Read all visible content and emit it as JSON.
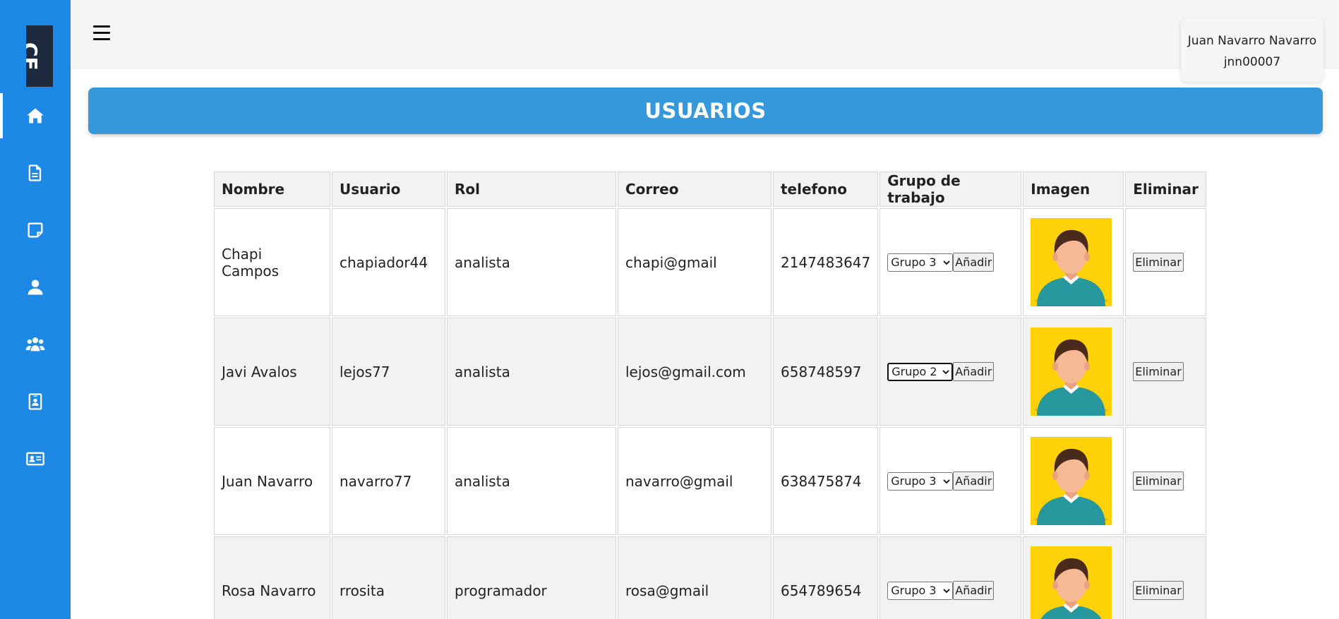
{
  "sidebar": {
    "logo_text": "CE",
    "items": [
      {
        "icon": "home-icon",
        "active": true
      },
      {
        "icon": "file-icon"
      },
      {
        "icon": "note-icon"
      },
      {
        "icon": "user-icon"
      },
      {
        "icon": "users-icon"
      },
      {
        "icon": "id-badge-icon"
      },
      {
        "icon": "id-card-icon"
      }
    ],
    "colors": {
      "background": "#1e88e5",
      "logo_bg": "#1e2a3d"
    }
  },
  "header": {
    "user": {
      "name": "Juan Navarro Navarro",
      "username": "jnn00007"
    }
  },
  "page": {
    "title": "USUARIOS",
    "title_color": "#3498db"
  },
  "table": {
    "headers": [
      "Nombre",
      "Usuario",
      "Rol",
      "Correo",
      "telefono",
      "Grupo de trabajo",
      "Imagen",
      "Eliminar"
    ],
    "rows": [
      {
        "nombre": "Chapi Campos",
        "usuario": "chapiador44",
        "rol": "analista",
        "correo": "chapi@gmail",
        "telefono": "2147483647",
        "grupo": "Grupo 3",
        "add_label": "Añadir",
        "delete_label": "Eliminar",
        "avatar": "male-avatar-icon"
      },
      {
        "nombre": "Javi Avalos",
        "usuario": "lejos77",
        "rol": "analista",
        "correo": "lejos@gmail.com",
        "telefono": "658748597",
        "grupo": "Grupo 2",
        "add_label": "Añadir",
        "delete_label": "Eliminar",
        "avatar": "male-avatar-icon"
      },
      {
        "nombre": "Juan Navarro",
        "usuario": "navarro77",
        "rol": "analista",
        "correo": "navarro@gmail",
        "telefono": "638475874",
        "grupo": "Grupo 3",
        "add_label": "Añadir",
        "delete_label": "Eliminar",
        "avatar": "male-avatar-icon"
      },
      {
        "nombre": "Rosa Navarro",
        "usuario": "rrosita",
        "rol": "programador",
        "correo": "rosa@gmail",
        "telefono": "654789654",
        "grupo": "Grupo 3",
        "add_label": "Añadir",
        "delete_label": "Eliminar",
        "avatar": "male-avatar-icon"
      }
    ]
  }
}
